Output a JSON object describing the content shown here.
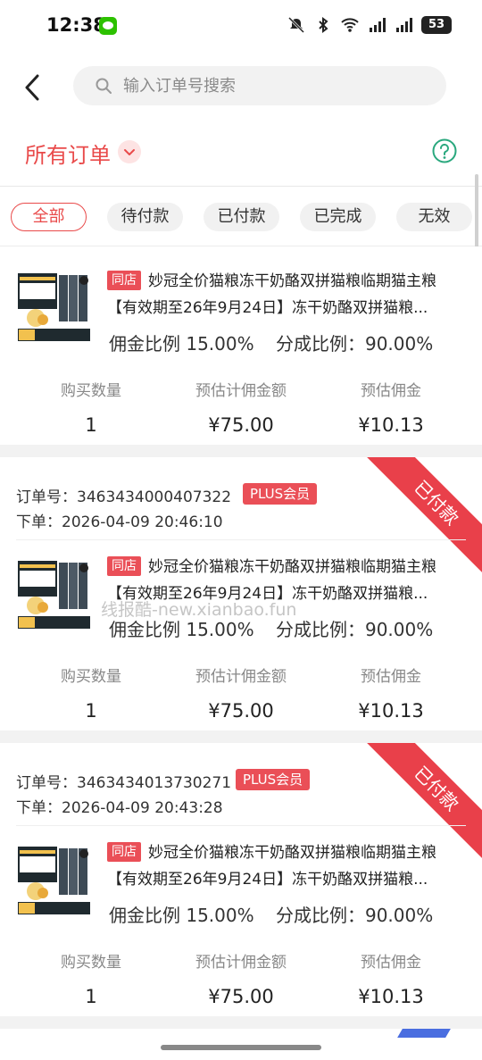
{
  "status_bar": {
    "time": "12:38",
    "battery": "53"
  },
  "search": {
    "placeholder": "输入订单号搜索"
  },
  "header": {
    "title": "所有订单"
  },
  "tabs": [
    {
      "label": "全部",
      "active": true
    },
    {
      "label": "待付款"
    },
    {
      "label": "已付款"
    },
    {
      "label": "已完成"
    },
    {
      "label": "无效"
    }
  ],
  "labels": {
    "shop_badge": "同店",
    "order_prefix": "订单号：",
    "time_prefix": "下单：",
    "qty": "购买数量",
    "est_amount": "预估计佣金额",
    "est_commission": "预估佣金"
  },
  "orders": [
    {
      "product_title": "妙冠全价猫粮冻干奶酪双拼猫粮临期猫主粮【有效期至26年9月24日】冻干奶酪双拼猫粮...",
      "commission_rate": "佣金比例 15.00%",
      "share_rate": "分成比例：90.00%",
      "qty": "1",
      "amount": "¥75.00",
      "commission": "¥10.13"
    },
    {
      "order_no": "3463434000407322",
      "badge": "PLUS会员",
      "time": "2026-04-09 20:46:10",
      "status": "已付款",
      "product_title": "妙冠全价猫粮冻干奶酪双拼猫粮临期猫主粮【有效期至26年9月24日】冻干奶酪双拼猫粮...",
      "commission_rate": "佣金比例 15.00%",
      "share_rate": "分成比例：90.00%",
      "qty": "1",
      "amount": "¥75.00",
      "commission": "¥10.13"
    },
    {
      "order_no": "3463434013730271",
      "badge": "PLUS会员",
      "time": "2026-04-09 20:43:28",
      "status": "已付款",
      "product_title": "妙冠全价猫粮冻干奶酪双拼猫粮临期猫主粮【有效期至26年9月24日】冻干奶酪双拼猫粮...",
      "commission_rate": "佣金比例 15.00%",
      "share_rate": "分成比例：90.00%",
      "qty": "1",
      "amount": "¥75.00",
      "commission": "¥10.13"
    }
  ],
  "watermark": "线报酷-new.xianbao.fun",
  "colors": {
    "accent": "#e94a4a",
    "help": "#2aa87e"
  }
}
